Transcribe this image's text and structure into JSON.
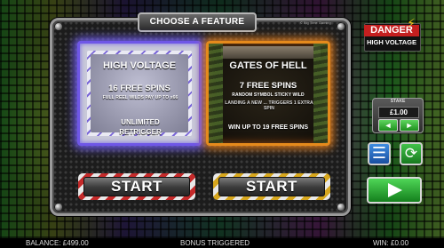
{
  "header": {
    "title": "CHOOSE A FEATURE",
    "brand": "© Big Time Gaming"
  },
  "features": [
    {
      "title": "HIGH VOLTAGE",
      "spins": "16 FREE SPINS",
      "desc": "FULL REEL WILDS PAY UP TO x66",
      "extra": "UNLIMITED RETRIGGER",
      "button": "START"
    },
    {
      "title": "GATES OF HELL",
      "spins": "7 FREE SPINS",
      "desc": "RANDOM SYMBOL STICKY WILD",
      "desc2": "LANDING A NEW ... TRIGGERS 1 EXTRA SPIN",
      "extra": "WIN UP TO 19 FREE SPINS",
      "button": "START"
    }
  ],
  "logo": {
    "line1": "DANGER",
    "line2": "HIGH VOLTAGE"
  },
  "stake": {
    "label": "STAKE",
    "value": "£1.00",
    "dec": "◄",
    "inc": "►"
  },
  "controls": {
    "menu_icon": "hamburger-icon",
    "autoplay_icon": "autoplay-icon",
    "spin_icon": "play-icon"
  },
  "status_bar": {
    "balance": "BALANCE: £499.00",
    "message": "BONUS TRIGGERED",
    "win": "WIN: £0.00"
  },
  "colors": {
    "high_voltage_border": "#6f57e7",
    "gates_border": "#e58a1c",
    "start_red": "#c42a2a",
    "start_yellow": "#d6a61d",
    "spin_green": "#4fd657"
  }
}
